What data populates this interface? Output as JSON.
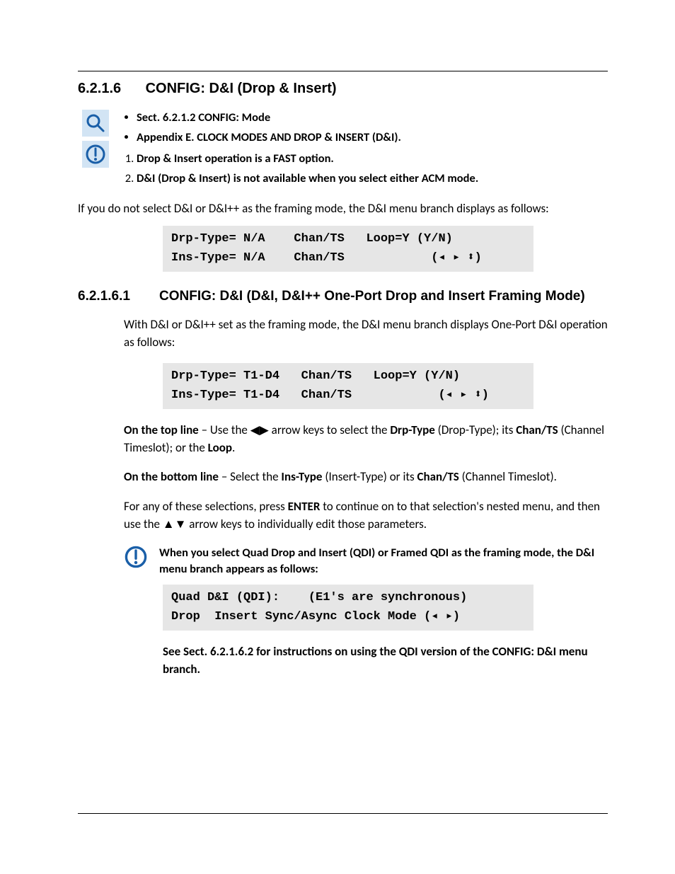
{
  "section": {
    "number": "6.2.1.6",
    "title": "CONFIG: D&I (Drop & Insert)"
  },
  "refs": {
    "ref1": "Sect. 6.2.1.2 CONFIG: Mode",
    "ref2a": "Appendix E. CLOCK MODES ",
    "ref2b": "AND",
    "ref2c": " DROP & INSERT (D&I)."
  },
  "notes": {
    "n1": "Drop & Insert operation is a FAST option.",
    "n2": "D&I (Drop & Insert) is not available when you select either ACM mode."
  },
  "para1": "If you do not select D&I or D&I++ as the framing mode, the D&I menu branch displays as follows:",
  "code1": "Drp-Type= N/A    Chan/TS   Loop=Y (Y/N)\nIns-Type= N/A    Chan/TS            (◂ ▸ ⬍)",
  "subsection": {
    "number": "6.2.1.6.1",
    "title": "CONFIG: D&I (D&I, D&I++ One-Port Drop and Insert Framing Mode)"
  },
  "para2": "With D&I or D&I++ set as the framing mode, the D&I menu branch displays One-Port D&I operation as follows:",
  "code2": "Drp-Type= T1-D4   Chan/TS   Loop=Y (Y/N)\nIns-Type= T1-D4   Chan/TS            (◂ ▸ ⬍)",
  "topline": {
    "label": "On the top line",
    "p1": " – Use the ◀▶ arrow keys to select the ",
    "b1": "Drp-Type",
    "p2": " (Drop-Type); its ",
    "b2": "Chan/TS",
    "p3": " (Channel Timeslot); or the ",
    "b3": "Loop",
    "p4": "."
  },
  "bottomline": {
    "label": "On the bottom line",
    "p1": " – Select the ",
    "b1": "Ins-Type",
    "p2": " (Insert-Type) or its ",
    "b2": "Chan/TS",
    "p3": " (Channel Timeslot)."
  },
  "para5a": "For any of these selections, press ",
  "para5b": "ENTER",
  "para5c": " to continue on to that selection's nested menu, and then use the ▲▼ arrow keys to individually edit those parameters.",
  "qdi_note": "When you select Quad Drop and Insert (QDI) or Framed QDI as the framing mode, the D&I menu branch appears as follows:",
  "code3": "Quad D&I (QDI):    (E1's are synchronous)\nDrop  Insert Sync/Async Clock Mode (◂ ▸)",
  "para6": "See Sect. 6.2.1.6.2 for instructions on using the QDI version of the CONFIG: D&I menu branch."
}
